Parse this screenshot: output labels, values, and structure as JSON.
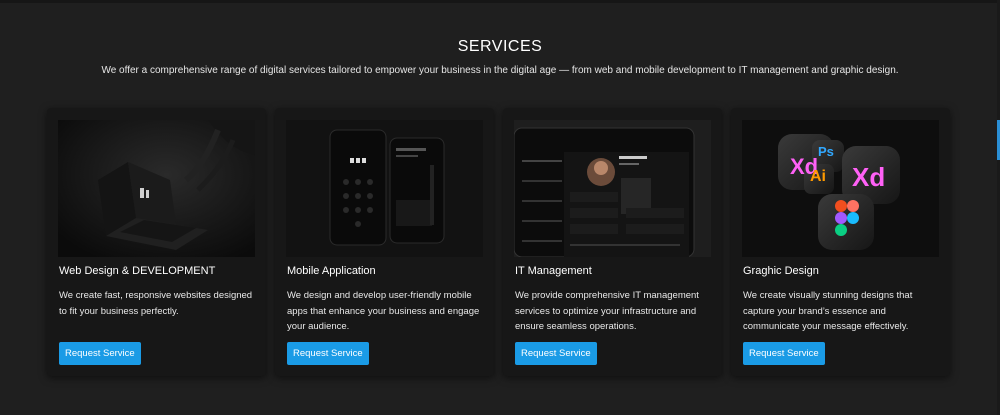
{
  "section": {
    "title": "SERVICES",
    "subtitle": "We offer a comprehensive range of digital services tailored to empower your business in the digital age — from web and mobile development to IT management and graphic design."
  },
  "cards": [
    {
      "title": "Web Design & DEVELOPMENT",
      "description": "We create fast, responsive websites designed to fit your business perfectly.",
      "button_label": "Request Service",
      "image_icon": "laptop-mockup-image"
    },
    {
      "title": "Mobile Application",
      "description": "We design and develop user-friendly mobile apps that enhance your business and engage your audience.",
      "button_label": "Request Service",
      "image_icon": "phone-mockup-image"
    },
    {
      "title": "IT Management",
      "description": "We provide comprehensive IT management services to optimize your infrastructure and ensure seamless operations.",
      "button_label": "Request Service",
      "image_icon": "tablet-dashboard-image"
    },
    {
      "title": "Graghic Design",
      "description": "We create visually stunning designs that capture your brand’s essence and communicate your message effectively.",
      "button_label": "Request Service",
      "image_icon": "design-apps-icons-image"
    }
  ],
  "design_icons": {
    "xd": "Xd",
    "ps": "Ps",
    "ai": "Ai"
  },
  "colors": {
    "background": "#1f1f1f",
    "card": "#171717",
    "button": "#1a9be6",
    "accent": "#2a8fd6"
  }
}
